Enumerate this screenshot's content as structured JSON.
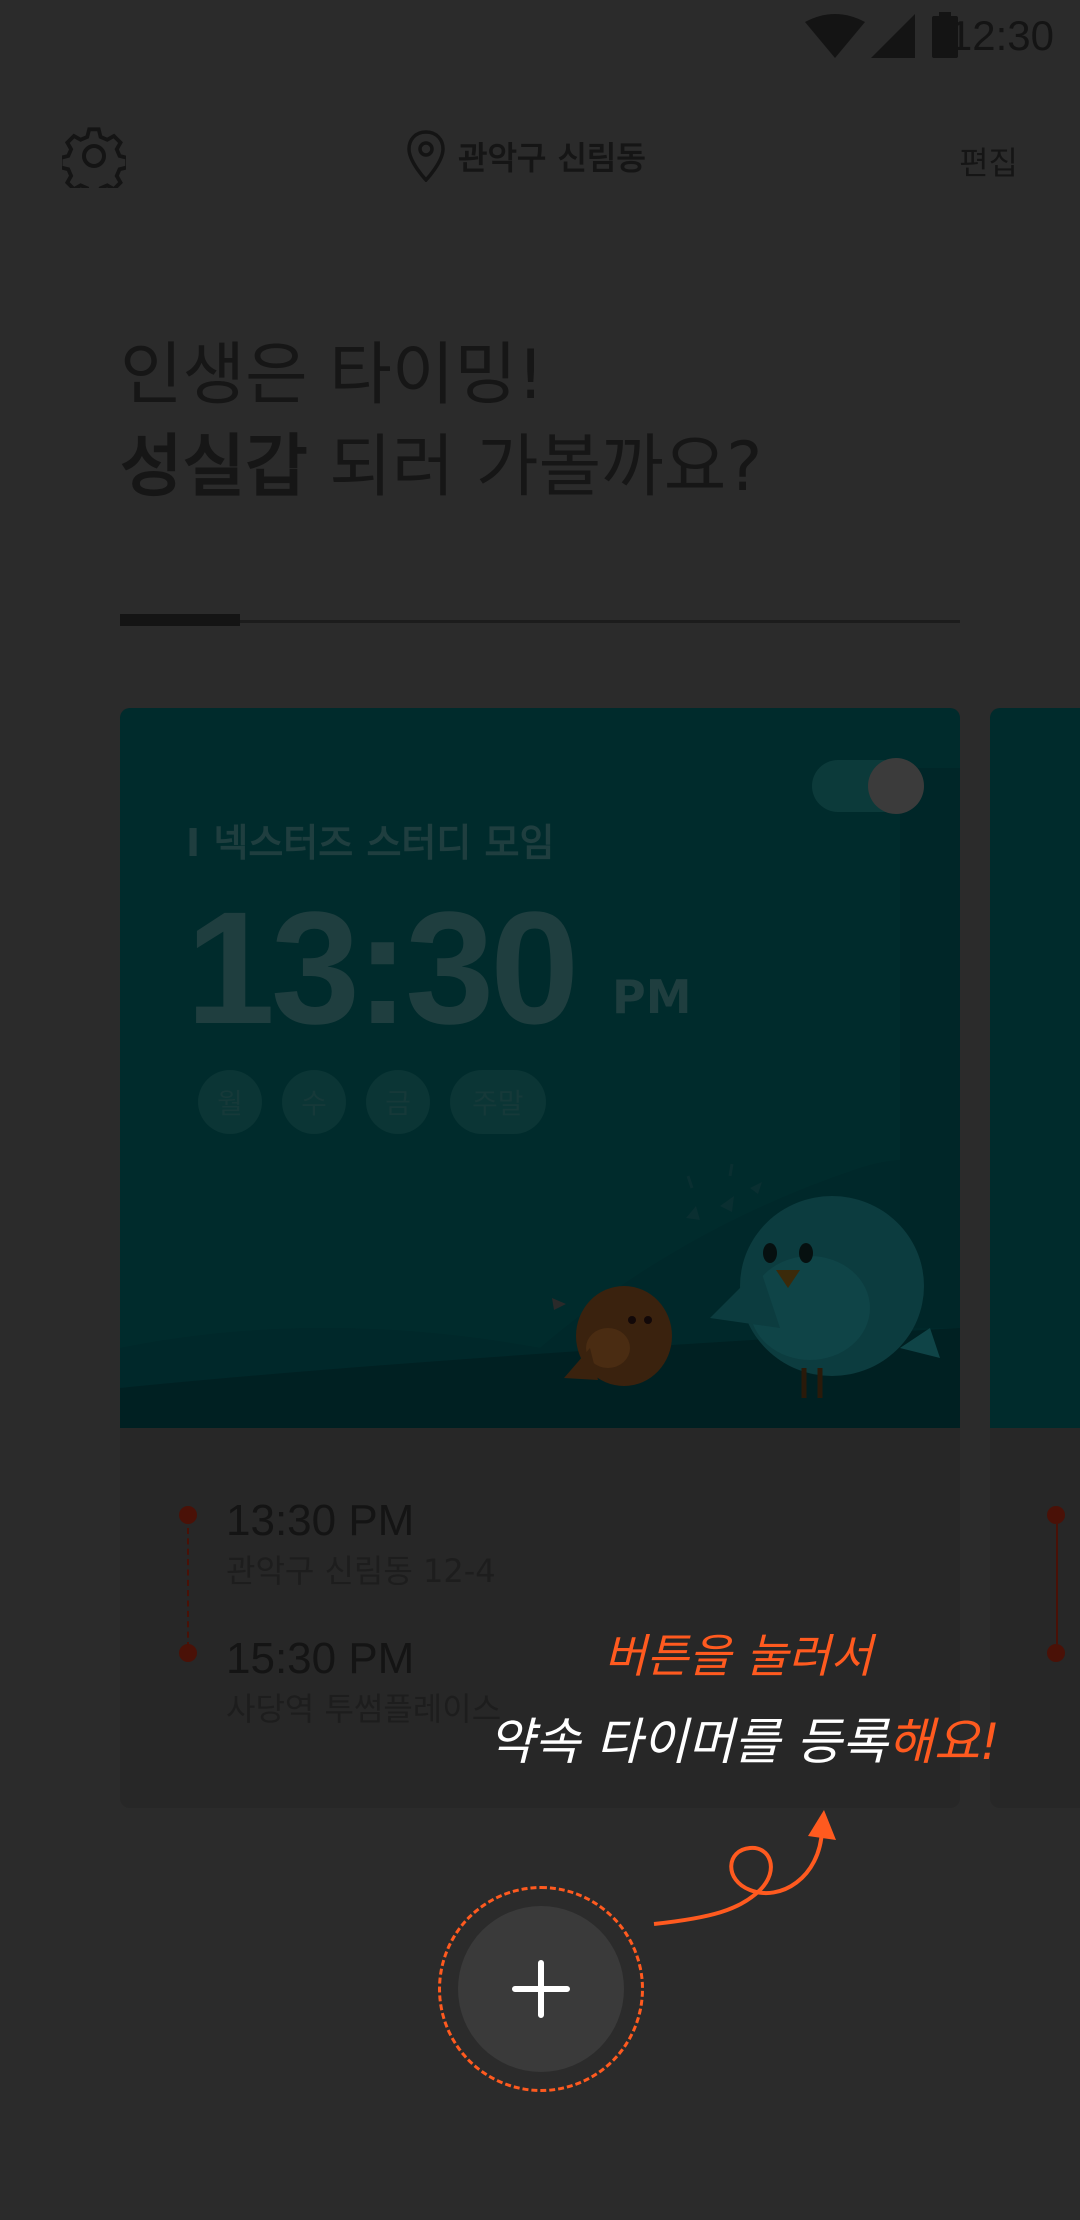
{
  "status_bar": {
    "time": "12:30"
  },
  "header": {
    "settings_icon": "gear-icon",
    "location_icon": "map-pin-icon",
    "location": "관악구 신림동",
    "edit_label": "편집"
  },
  "headline": {
    "line1": "인생은 타이밍!",
    "line2_bold": "성실갑",
    "line2_rest": " 되러 가볼까요?"
  },
  "carousel": {
    "page_index": 1,
    "page_count": 7
  },
  "card": {
    "title": "넥스터즈 스터디 모임",
    "time": "13:30",
    "ampm": "PM",
    "enabled": true,
    "days": [
      "월",
      "수",
      "금",
      "주말"
    ],
    "route": [
      {
        "time": "13:30 PM",
        "place": "관악구 신림동 12-4"
      },
      {
        "time": "15:30 PM",
        "place": "사당역 투썸플레이스"
      }
    ]
  },
  "hint": {
    "line1": "버튼을 눌러서",
    "line2_main": "약속 타이머를 등록",
    "line2_accent": "해요!"
  },
  "fab": {
    "icon": "plus-icon",
    "accent_color": "#ff5a1f"
  }
}
